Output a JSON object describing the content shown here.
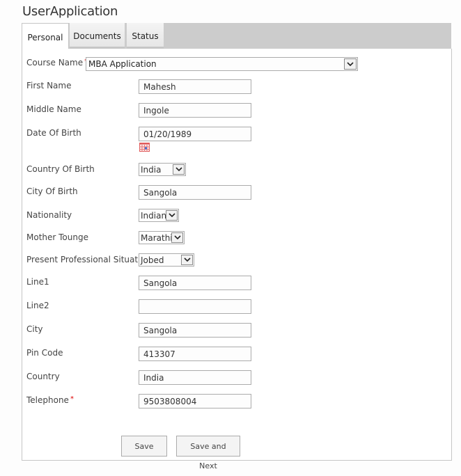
{
  "page": {
    "title": "UserApplication"
  },
  "tabs": [
    {
      "label": "Personal",
      "active": true
    },
    {
      "label": "Documents",
      "active": false
    },
    {
      "label": "Status",
      "active": false
    }
  ],
  "form": {
    "required_marker": "*",
    "course_name": {
      "label": "Course Name",
      "value": "MBA Application",
      "required": true
    },
    "first_name": {
      "label": "First Name",
      "value": "Mahesh"
    },
    "middle_name": {
      "label": "Middle Name",
      "value": "Ingole"
    },
    "date_of_birth": {
      "label": "Date Of Birth",
      "value": "01/20/1989"
    },
    "country_of_birth": {
      "label": "Country Of Birth",
      "value": "India"
    },
    "city_of_birth": {
      "label": "City Of Birth",
      "value": "Sangola"
    },
    "nationality": {
      "label": "Nationality",
      "value": "Indian"
    },
    "mother_tounge": {
      "label": "Mother Tounge",
      "value": "Marathi"
    },
    "professional_situation": {
      "label": "Present Professional Situation",
      "value": "Jobed"
    },
    "line1": {
      "label": "Line1",
      "value": "Sangola"
    },
    "line2": {
      "label": "Line2",
      "value": ""
    },
    "city": {
      "label": "City",
      "value": "Sangola"
    },
    "pin_code": {
      "label": "Pin Code",
      "value": "413307"
    },
    "country": {
      "label": "Country",
      "value": "India"
    },
    "telephone": {
      "label": "Telephone",
      "value": "9503808004",
      "required": true
    }
  },
  "buttons": {
    "save": "Save",
    "save_next": "Save and Next"
  },
  "icons": {
    "calendar": "calendar-icon",
    "dropdown": "chevron-down-icon"
  },
  "colors": {
    "required": "#dd0000",
    "tabbar": "#cccccc",
    "border": "#ababab"
  }
}
